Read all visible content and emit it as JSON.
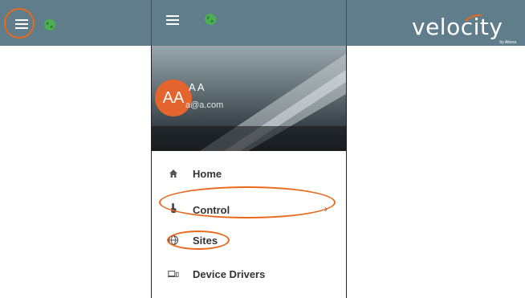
{
  "topbar": {
    "bg_color": "#607d8b",
    "menu_icon": "hamburger-icon",
    "globe_icon": "globe-icon",
    "globe_color": "#4caf50"
  },
  "logo": {
    "text": "velocity",
    "sub_text": "by Atlona"
  },
  "drawer": {
    "user": {
      "initials": "AA",
      "name": "A A",
      "email": "a@a.com",
      "avatar_color": "#e4642d"
    },
    "items": [
      {
        "label": "Home",
        "icon": "home-icon"
      },
      {
        "label": "Control",
        "icon": "touch-icon",
        "has_chevron": true,
        "chevron": "›"
      },
      {
        "label": "Sites",
        "icon": "globe-icon"
      },
      {
        "label": "Device Drivers",
        "icon": "devices-icon"
      }
    ]
  },
  "highlight_color": "#e8691c"
}
